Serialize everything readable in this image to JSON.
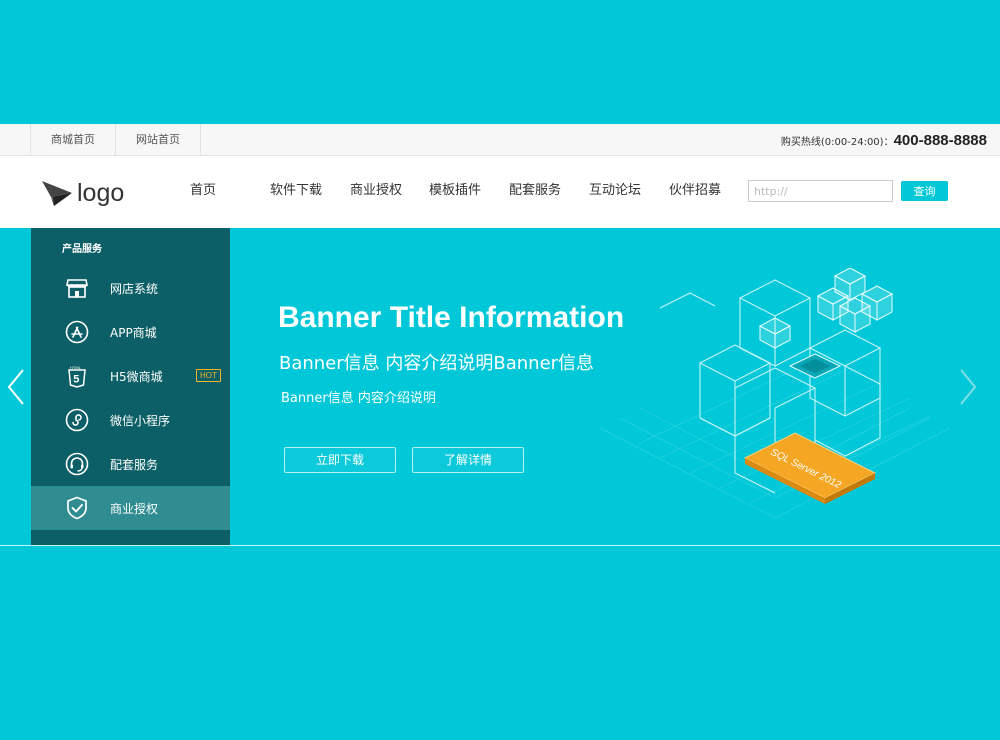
{
  "topbar": {
    "links": [
      "商城首页",
      "网站首页"
    ],
    "hotline_label": "购买热线(0:00-24:00)：",
    "hotline_number": "400-888-8888"
  },
  "header": {
    "logo_text": "logo",
    "nav": [
      "首页",
      "软件下载",
      "商业授权",
      "模板插件",
      "配套服务",
      "互动论坛",
      "伙伴招募"
    ],
    "search_placeholder": "http://",
    "search_button": "查询"
  },
  "sidebar": {
    "heading": "产品服务",
    "items": [
      {
        "label": "网店系统",
        "icon": "shop-icon"
      },
      {
        "label": "APP商城",
        "icon": "app-store-icon"
      },
      {
        "label": "H5微商城",
        "icon": "html5-icon",
        "badge": "HOT"
      },
      {
        "label": "微信小程序",
        "icon": "mini-program-icon"
      },
      {
        "label": "配套服务",
        "icon": "headset-icon"
      },
      {
        "label": "商业授权",
        "icon": "shield-check-icon"
      }
    ],
    "active_index": 5
  },
  "banner": {
    "title": "Banner Title Information",
    "subtitle": "Banner信息 内容介绍说明Banner信息",
    "description": "Banner信息 内容介绍说明",
    "button_primary": "立即下载",
    "button_secondary": "了解详情",
    "illustration_label": "SQL Server 2012"
  },
  "colors": {
    "background": "#00c8d8",
    "sidebar": "#0c5f66",
    "sidebar_active": "#2f8c91",
    "accent_orange": "#f5a623"
  }
}
